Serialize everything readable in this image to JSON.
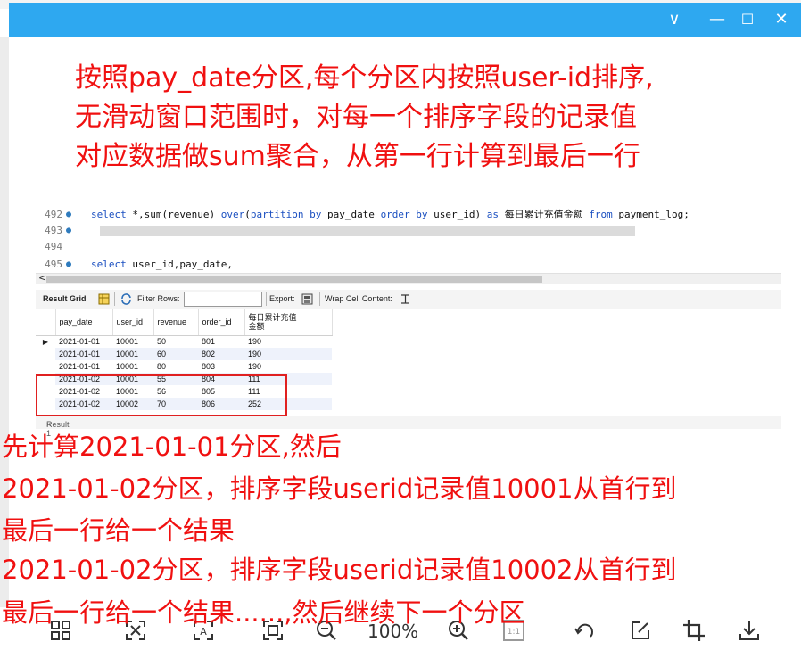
{
  "window": {
    "controls": {
      "chevron": "∨",
      "minimize": "—",
      "maximize": "☐",
      "close": "✕"
    }
  },
  "notes": {
    "top": [
      "按照pay_date分区,每个分区内按照user-id排序,",
      "无滑动窗口范围时，对每一个排序字段的记录值",
      "对应数据做sum聚合，从第一行计算到最后一行"
    ],
    "bottom": [
      "先计算2021-01-01分区,然后",
      "2021-01-02分区，排序字段userid记录值10001从首行到",
      "最后一行给一个结果",
      "2021-01-02分区，排序字段userid记录值10002从首行到",
      "最后一行给一个结果......,然后继续下一个分区"
    ]
  },
  "editor": {
    "lines": [
      {
        "num": "492",
        "marker": "●",
        "kw1": "select",
        "p1": " *,sum(revenue) ",
        "kw2": "over",
        "p2": "(",
        "kw3": "partition by",
        "p3": " pay_date ",
        "kw4": "order by",
        "p4": " user_id) ",
        "kw5": "as",
        "p5": " 每日累计充值金额 ",
        "kw6": "from",
        "p6": "  payment_log;"
      },
      {
        "num": "493",
        "marker": "●"
      },
      {
        "num": "494",
        "marker": ""
      },
      {
        "num": "495",
        "marker": "●",
        "kw1": "select",
        "p1": " user_id,pay_date,"
      }
    ]
  },
  "toolbar": {
    "result_grid": "Result Grid",
    "filter_rows": "Filter Rows:",
    "filter_value": "",
    "export": "Export:",
    "wrap": "Wrap Cell Content:"
  },
  "grid": {
    "columns": [
      "pay_date",
      "user_id",
      "revenue",
      "order_id",
      "每日累计充值\n金额"
    ],
    "rows": [
      [
        "2021-01-01",
        "10001",
        "50",
        "801",
        "190"
      ],
      [
        "2021-01-01",
        "10001",
        "60",
        "802",
        "190"
      ],
      [
        "2021-01-01",
        "10001",
        "80",
        "803",
        "190"
      ],
      [
        "2021-01-02",
        "10001",
        "55",
        "804",
        "111"
      ],
      [
        "2021-01-02",
        "10001",
        "56",
        "805",
        "111"
      ],
      [
        "2021-01-02",
        "10002",
        "70",
        "806",
        "252"
      ]
    ],
    "current_row_marker": "▶"
  },
  "result_tab": {
    "label": "Result 1",
    "close": "×"
  },
  "bottom_toolbar": {
    "zoom": "100%",
    "ratio": "1:1"
  },
  "colors": {
    "titlebar": "#2ea8f0",
    "annotation": "#f01010",
    "keyword": "#1a4fc0",
    "highlight_box": "#e02020"
  }
}
